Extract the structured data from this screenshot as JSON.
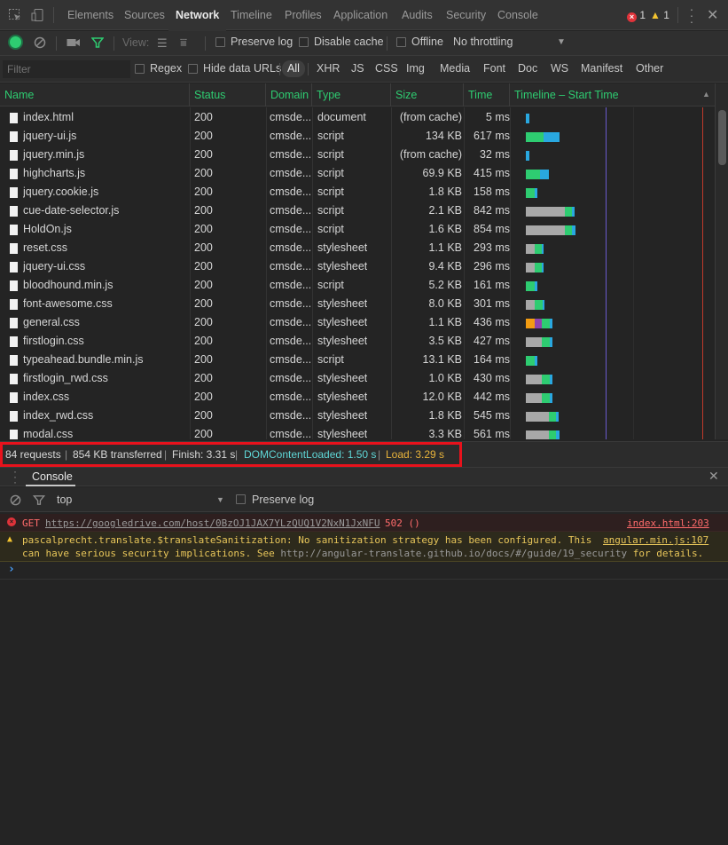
{
  "tabs": [
    "Elements",
    "Sources",
    "Network",
    "Timeline",
    "Profiles",
    "Application",
    "Audits",
    "Security",
    "Console"
  ],
  "active_tab": "Network",
  "badges": {
    "errors": "1",
    "warnings": "1"
  },
  "network_toolbar": {
    "view_label": "View:",
    "preserve_log": "Preserve log",
    "disable_cache": "Disable cache",
    "offline": "Offline",
    "throttling": "No throttling"
  },
  "filter_bar": {
    "placeholder": "Filter",
    "regex": "Regex",
    "hide_data_urls": "Hide data URLs",
    "types": [
      "All",
      "XHR",
      "JS",
      "CSS",
      "Img",
      "Media",
      "Font",
      "Doc",
      "WS",
      "Manifest",
      "Other"
    ]
  },
  "columns": [
    "Name",
    "Status",
    "Domain",
    "Type",
    "Size",
    "Time",
    "Timeline – Start Time"
  ],
  "requests": [
    {
      "name": "index.html",
      "status": "200",
      "domain": "cmsde...",
      "type": "document",
      "size": "(from cache)",
      "time": "5 ms"
    },
    {
      "name": "jquery-ui.js",
      "status": "200",
      "domain": "cmsde...",
      "type": "script",
      "size": "134 KB",
      "time": "617 ms"
    },
    {
      "name": "jquery.min.js",
      "status": "200",
      "domain": "cmsde...",
      "type": "script",
      "size": "(from cache)",
      "time": "32 ms"
    },
    {
      "name": "highcharts.js",
      "status": "200",
      "domain": "cmsde...",
      "type": "script",
      "size": "69.9 KB",
      "time": "415 ms"
    },
    {
      "name": "jquery.cookie.js",
      "status": "200",
      "domain": "cmsde...",
      "type": "script",
      "size": "1.8 KB",
      "time": "158 ms"
    },
    {
      "name": "cue-date-selector.js",
      "status": "200",
      "domain": "cmsde...",
      "type": "script",
      "size": "2.1 KB",
      "time": "842 ms"
    },
    {
      "name": "HoldOn.js",
      "status": "200",
      "domain": "cmsde...",
      "type": "script",
      "size": "1.6 KB",
      "time": "854 ms"
    },
    {
      "name": "reset.css",
      "status": "200",
      "domain": "cmsde...",
      "type": "stylesheet",
      "size": "1.1 KB",
      "time": "293 ms"
    },
    {
      "name": "jquery-ui.css",
      "status": "200",
      "domain": "cmsde...",
      "type": "stylesheet",
      "size": "9.4 KB",
      "time": "296 ms"
    },
    {
      "name": "bloodhound.min.js",
      "status": "200",
      "domain": "cmsde...",
      "type": "script",
      "size": "5.2 KB",
      "time": "161 ms"
    },
    {
      "name": "font-awesome.css",
      "status": "200",
      "domain": "cmsde...",
      "type": "stylesheet",
      "size": "8.0 KB",
      "time": "301 ms"
    },
    {
      "name": "general.css",
      "status": "200",
      "domain": "cmsde...",
      "type": "stylesheet",
      "size": "1.1 KB",
      "time": "436 ms"
    },
    {
      "name": "firstlogin.css",
      "status": "200",
      "domain": "cmsde...",
      "type": "stylesheet",
      "size": "3.5 KB",
      "time": "427 ms"
    },
    {
      "name": "typeahead.bundle.min.js",
      "status": "200",
      "domain": "cmsde...",
      "type": "script",
      "size": "13.1 KB",
      "time": "164 ms"
    },
    {
      "name": "firstlogin_rwd.css",
      "status": "200",
      "domain": "cmsde...",
      "type": "stylesheet",
      "size": "1.0 KB",
      "time": "430 ms"
    },
    {
      "name": "index.css",
      "status": "200",
      "domain": "cmsde...",
      "type": "stylesheet",
      "size": "12.0 KB",
      "time": "442 ms"
    },
    {
      "name": "index_rwd.css",
      "status": "200",
      "domain": "cmsde...",
      "type": "stylesheet",
      "size": "1.8 KB",
      "time": "545 ms"
    },
    {
      "name": "modal.css",
      "status": "200",
      "domain": "cmsde...",
      "type": "stylesheet",
      "size": "3.3 KB",
      "time": "561 ms"
    }
  ],
  "status_bar": {
    "requests": "84 requests",
    "transferred": "854 KB transferred",
    "finish": "Finish: 3.31 s",
    "dom_content_loaded": "DOMContentLoaded: 1.50 s",
    "load": "Load: 3.29 s"
  },
  "console": {
    "title": "Console",
    "context": "top",
    "preserve_log": "Preserve log",
    "error": {
      "method": "GET",
      "url": "https://googledrive.com/host/0BzOJ1JAX7YLzQUQ1V2NxN1JxNFU",
      "code": "502 ()",
      "source": "index.html:203"
    },
    "warning": {
      "line1": "pascalprecht.translate.$translateSanitization: No sanitization strategy has been configured. This",
      "line2_a": "can have serious security implications. See",
      "line2_url": "http://angular-translate.github.io/docs/#/guide/19_security",
      "line2_b": "for details.",
      "source": "angular.min.js:107"
    },
    "prompt": "›"
  },
  "colors": {
    "accent_green": "#2ecc71",
    "dom_content_loaded": "#5fd6d6",
    "load": "#e8b33b",
    "error": "#ff6b6b",
    "warning": "#e8c65a",
    "highlight_box": "#e8121c"
  }
}
